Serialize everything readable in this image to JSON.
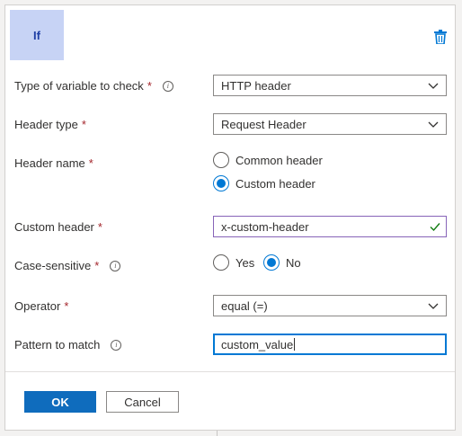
{
  "header": {
    "tile_label": "If",
    "delete_icon": "trash-icon"
  },
  "colors": {
    "accent": "#0078d4",
    "required": "#a4262c",
    "tile_bg": "#c7d3f5",
    "tile_text": "#1f3fa5",
    "valid_border": "#8764b8"
  },
  "form": {
    "variable_type": {
      "label": "Type of variable to check",
      "required": "*",
      "info": "i",
      "value": "HTTP header"
    },
    "header_type": {
      "label": "Header type",
      "required": "*",
      "value": "Request Header"
    },
    "header_name": {
      "label": "Header name",
      "required": "*",
      "options": [
        "Common header",
        "Custom header"
      ],
      "selected": "Custom header"
    },
    "custom_header": {
      "label": "Custom header",
      "required": "*",
      "value": "x-custom-header"
    },
    "case_sensitive": {
      "label": "Case-sensitive",
      "required": "*",
      "info": "i",
      "options": [
        "Yes",
        "No"
      ],
      "selected": "No"
    },
    "operator": {
      "label": "Operator",
      "required": "*",
      "value": "equal (=)"
    },
    "pattern": {
      "label": "Pattern to match",
      "info": "i",
      "value": "custom_value"
    }
  },
  "footer": {
    "ok_label": "OK",
    "cancel_label": "Cancel"
  }
}
